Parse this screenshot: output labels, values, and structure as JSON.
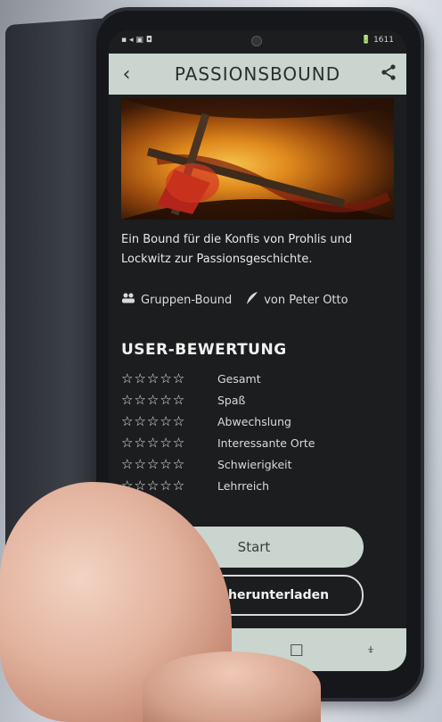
{
  "status": {
    "left_icons": "▪ ◂ ▣ ◘",
    "right": "🔋 1611"
  },
  "appbar": {
    "back_glyph": "‹",
    "title": "PASSIONSBOUND",
    "share_glyph": "share-icon"
  },
  "description": "Ein Bound für die Konfis von Prohlis und Lockwitz zur Passionsgeschichte.",
  "meta": {
    "group_label": "Gruppen-Bound",
    "author_label": "von Peter Otto"
  },
  "rating": {
    "heading": "USER-BEWERTUNG",
    "star_glyphs": "☆☆☆☆☆",
    "items": [
      {
        "label": "Gesamt"
      },
      {
        "label": "Spaß"
      },
      {
        "label": "Abwechslung"
      },
      {
        "label": "Interessante Orte"
      },
      {
        "label": "Schwierigkeit"
      },
      {
        "label": "Lehrreich"
      }
    ]
  },
  "buttons": {
    "start": "Start",
    "download": "Bound herunterladen"
  },
  "navbar": {
    "back": "◁",
    "home": "○",
    "recents": "□",
    "extra": "⍖"
  },
  "colors": {
    "accent": "#c9d5ce",
    "screen_bg": "#1b1d1f"
  }
}
